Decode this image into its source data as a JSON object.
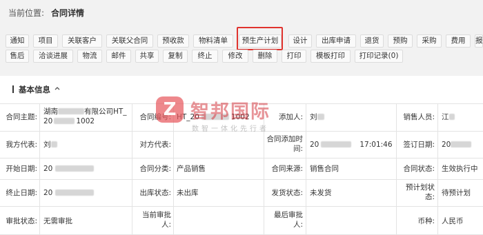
{
  "breadcrumb": {
    "label": "当前位置:",
    "current": "合同详情"
  },
  "toolbar": {
    "row1": [
      "通知",
      "项目",
      "关联客户",
      "关联父合同",
      "预收款",
      "物料清单",
      "预生产计划",
      "设计",
      "出库申请",
      "退货",
      "预购",
      "采购",
      "费用",
      "报"
    ],
    "row2": [
      "售后",
      "洽谈进展",
      "物流",
      "邮件",
      "共享",
      "复制",
      "终止",
      "修改",
      "删除",
      "打印",
      "模板打印",
      "打印记录(0)"
    ],
    "highlighted": "预生产计划"
  },
  "section": {
    "title": "基本信息"
  },
  "watermark": {
    "glyph": "Z",
    "title": "智邦国际",
    "subtitle": "数智一体化先行者"
  },
  "fields": {
    "contract_subject_label": "合同主题:",
    "contract_subject_line1_prefix": "湖南",
    "contract_subject_line1_suffix": "有限公司HT_",
    "contract_subject_line2_prefix": "20",
    "contract_subject_line2_suffix": "1002",
    "contract_no_label": "合同编号:",
    "contract_no_prefix": "HT_20",
    "contract_no_suffix": "1002",
    "added_by_label": "添加人:",
    "added_by_value": "刘",
    "sales_label": "销售人员:",
    "sales_value": "江",
    "our_rep_label": "我方代表:",
    "our_rep_value": "刘",
    "their_rep_label": "对方代表:",
    "added_time_label_1": "合同添加时",
    "added_time_label_2": "间:",
    "added_time_prefix": "20",
    "added_time_suffix": "17:01:46",
    "sign_date_label": "签订日期:",
    "sign_date_value": "20",
    "start_date_label": "开始日期:",
    "start_date_value": "20",
    "category_label": "合同分类:",
    "category_value": "产品销售",
    "source_label": "合同来源:",
    "source_value": "销售合同",
    "status_label": "合同状态:",
    "status_value": "生效执行中",
    "end_date_label": "终止日期:",
    "end_date_value": "20",
    "outbound_label": "出库状态:",
    "outbound_value": "未出库",
    "ship_label": "发货状态:",
    "ship_value": "未发货",
    "plan_label_1": "预计划状",
    "plan_label_2": "态:",
    "plan_value": "待预计划",
    "approval_label": "审批状态:",
    "approval_value": "无需审批",
    "current_approver_label_1": "当前审批",
    "current_approver_label_2": "人:",
    "final_approver_label_1": "最后审批",
    "final_approver_label_2": "人:",
    "currency_label": "币种:",
    "currency_value": "人民币"
  }
}
